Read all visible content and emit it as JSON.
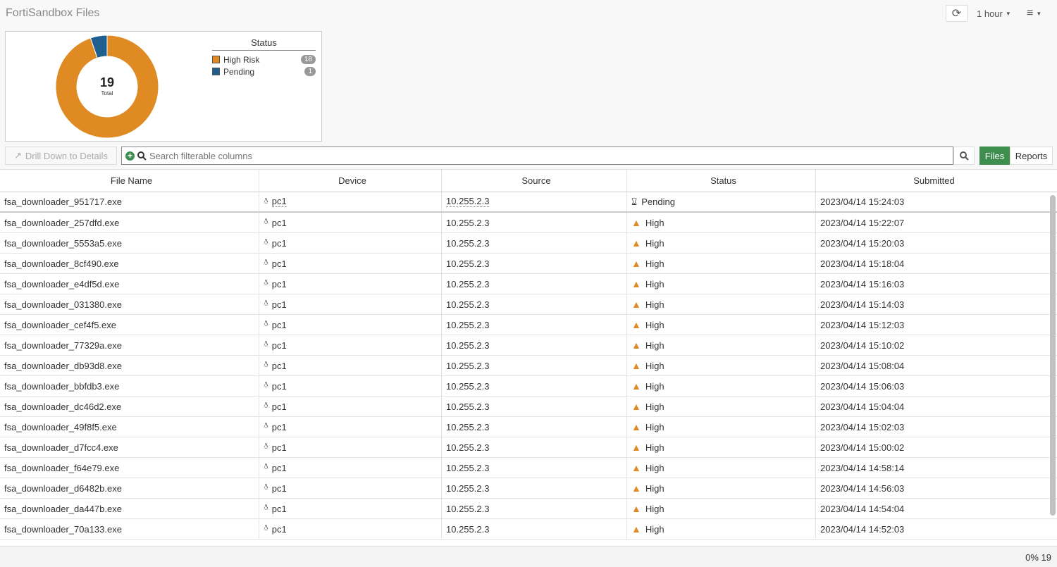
{
  "header": {
    "title": "FortiSandbox Files",
    "time_range": "1 hour"
  },
  "chart_data": {
    "type": "pie",
    "title": "Status",
    "center_value": "19",
    "center_label": "Total",
    "categories": [
      "High Risk",
      "Pending"
    ],
    "values": [
      18,
      1
    ],
    "colors": [
      "#e08a24",
      "#1f5f8f"
    ]
  },
  "toolbar": {
    "drill_label": "Drill Down to Details",
    "search_placeholder": "Search filterable columns",
    "files_label": "Files",
    "reports_label": "Reports"
  },
  "table": {
    "columns": [
      "File Name",
      "Device",
      "Source",
      "Status",
      "Submitted"
    ],
    "rows": [
      [
        "fsa_downloader_951717.exe",
        "pc1",
        "10.255.2.3",
        "Pending",
        "2023/04/14 15:24:03"
      ],
      [
        "fsa_downloader_257dfd.exe",
        "pc1",
        "10.255.2.3",
        "High",
        "2023/04/14 15:22:07"
      ],
      [
        "fsa_downloader_5553a5.exe",
        "pc1",
        "10.255.2.3",
        "High",
        "2023/04/14 15:20:03"
      ],
      [
        "fsa_downloader_8cf490.exe",
        "pc1",
        "10.255.2.3",
        "High",
        "2023/04/14 15:18:04"
      ],
      [
        "fsa_downloader_e4df5d.exe",
        "pc1",
        "10.255.2.3",
        "High",
        "2023/04/14 15:16:03"
      ],
      [
        "fsa_downloader_031380.exe",
        "pc1",
        "10.255.2.3",
        "High",
        "2023/04/14 15:14:03"
      ],
      [
        "fsa_downloader_cef4f5.exe",
        "pc1",
        "10.255.2.3",
        "High",
        "2023/04/14 15:12:03"
      ],
      [
        "fsa_downloader_77329a.exe",
        "pc1",
        "10.255.2.3",
        "High",
        "2023/04/14 15:10:02"
      ],
      [
        "fsa_downloader_db93d8.exe",
        "pc1",
        "10.255.2.3",
        "High",
        "2023/04/14 15:08:04"
      ],
      [
        "fsa_downloader_bbfdb3.exe",
        "pc1",
        "10.255.2.3",
        "High",
        "2023/04/14 15:06:03"
      ],
      [
        "fsa_downloader_dc46d2.exe",
        "pc1",
        "10.255.2.3",
        "High",
        "2023/04/14 15:04:04"
      ],
      [
        "fsa_downloader_49f8f5.exe",
        "pc1",
        "10.255.2.3",
        "High",
        "2023/04/14 15:02:03"
      ],
      [
        "fsa_downloader_d7fcc4.exe",
        "pc1",
        "10.255.2.3",
        "High",
        "2023/04/14 15:00:02"
      ],
      [
        "fsa_downloader_f64e79.exe",
        "pc1",
        "10.255.2.3",
        "High",
        "2023/04/14 14:58:14"
      ],
      [
        "fsa_downloader_d6482b.exe",
        "pc1",
        "10.255.2.3",
        "High",
        "2023/04/14 14:56:03"
      ],
      [
        "fsa_downloader_da447b.exe",
        "pc1",
        "10.255.2.3",
        "High",
        "2023/04/14 14:54:04"
      ],
      [
        "fsa_downloader_70a133.exe",
        "pc1",
        "10.255.2.3",
        "High",
        "2023/04/14 14:52:03"
      ]
    ]
  },
  "footer": {
    "status": "0% 19"
  }
}
